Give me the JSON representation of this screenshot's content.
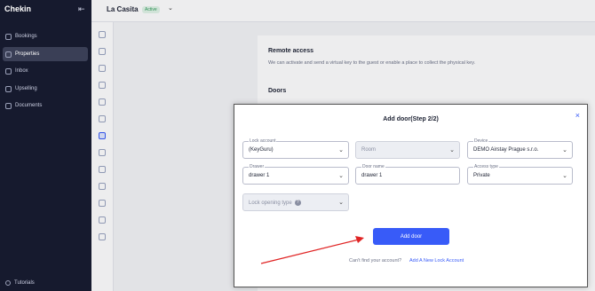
{
  "app": {
    "logo": "Chekin"
  },
  "sidebar": {
    "items": [
      {
        "label": "Bookings",
        "icon": "calendar-icon"
      },
      {
        "label": "Properties",
        "icon": "home-icon"
      },
      {
        "label": "Inbox",
        "icon": "inbox-icon"
      },
      {
        "label": "Upselling",
        "icon": "upselling-icon"
      },
      {
        "label": "Documents",
        "icon": "documents-icon"
      }
    ],
    "active_index": 1,
    "tutorials_label": "Tutorials"
  },
  "header": {
    "property_name": "La Casita",
    "status_badge": "Active"
  },
  "background": {
    "remote_access_title": "Remote access",
    "remote_access_desc": "We can activate and send a virtual key to the guest or enable a place to collect the physical key.",
    "doors_title": "Doors"
  },
  "modal": {
    "title": "Add door(Step 2/2)",
    "close_symbol": "×",
    "fields": {
      "lock_account": {
        "label": "Lock account",
        "value": "(KeyGuru)"
      },
      "room": {
        "placeholder": "Room"
      },
      "device": {
        "label": "Device",
        "value": "DEMO Airstay Prague s.r.o."
      },
      "drawer": {
        "label": "Drawer",
        "value": "drawer 1"
      },
      "door_name": {
        "label": "Door name",
        "value": "drawer 1"
      },
      "access_type": {
        "label": "Access type",
        "value": "Private"
      },
      "lock_opening_type": {
        "placeholder": "Lock opening type"
      }
    },
    "add_button": "Add door",
    "footer_question": "Can't find your account?",
    "footer_link": "Add A New Lock Account"
  },
  "colors": {
    "accent": "#385bf8",
    "sidebar_bg": "#161a2e",
    "annotation_arrow": "#e02424"
  }
}
